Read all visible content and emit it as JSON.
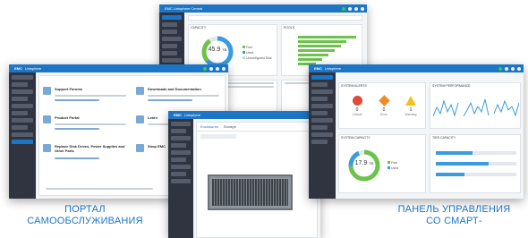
{
  "windows": {
    "top": {
      "title": "EMC Unisphere Central",
      "capacity_label": "CAPACITY",
      "capacity_value": "45.9",
      "capacity_unit": "TB",
      "pools_label": "POOLS",
      "legend": [
        "Free",
        "Used",
        "Unconfigured Disk"
      ]
    },
    "left": {
      "brand": "EMC",
      "app": "Unisphere",
      "support_title": "Support Forums",
      "docs_title": "Downloads and Documentation",
      "product_title": "Product Portal",
      "learn_title": "Learn",
      "replace_title": "Replace Disk Drives, Power Supplies and Other Parts",
      "shop_title": "Shop EMC"
    },
    "middle": {
      "brand": "EMC",
      "app": "Unisphere",
      "tabs": [
        "Enclosures",
        "Storage"
      ]
    },
    "right": {
      "brand": "EMC",
      "app": "Unisphere",
      "alerts_label": "SYSTEM ALERTS",
      "alerts": [
        {
          "count": "0",
          "label": "Critical",
          "color": "#e04a3b"
        },
        {
          "count": "0",
          "label": "Error",
          "color": "#f08a24"
        },
        {
          "count": "1",
          "label": "Warning",
          "color": "#f2c21b"
        }
      ],
      "perf_label": "SYSTEM PERFORMANCE",
      "capacity_label": "SYSTEM CAPACITY",
      "capacity_value": "17.9",
      "capacity_unit": "TB",
      "tier_label": "TIER CAPACITY",
      "legend": [
        "Free",
        "Used"
      ]
    }
  },
  "captions": {
    "left": [
      "ПОРТАЛ",
      "САМООБСЛУЖИВАНИЯ"
    ],
    "right": [
      "ПАНЕЛЬ УПРАВЛЕНИЯ",
      "СО СМАРТ-"
    ]
  }
}
